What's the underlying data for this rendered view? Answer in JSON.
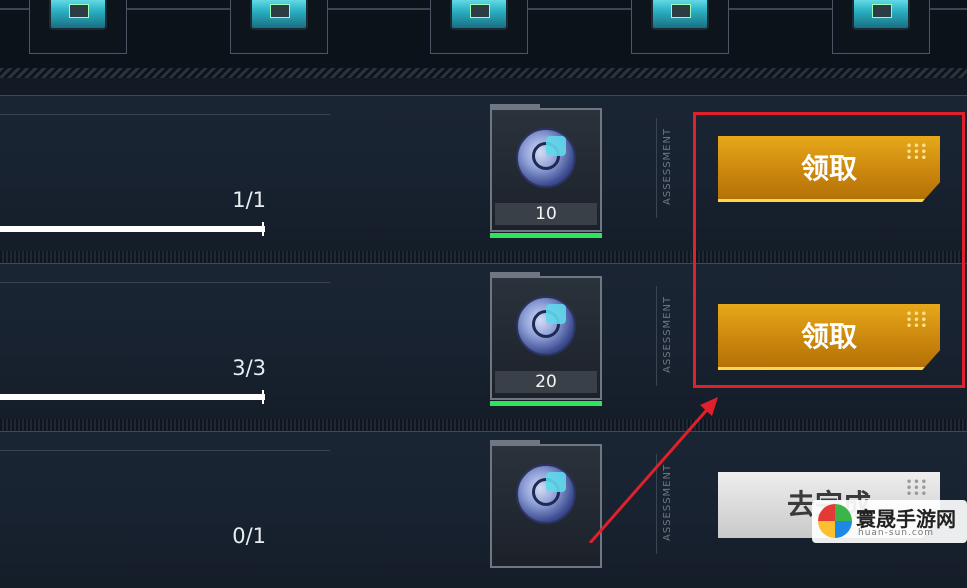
{
  "tasks": [
    {
      "progress": "1/1",
      "reward_qty": "10",
      "side_label": "ASSESSMENT",
      "button_label": "领取"
    },
    {
      "progress": "3/3",
      "reward_qty": "20",
      "side_label": "ASSESSMENT",
      "button_label": "领取"
    },
    {
      "progress": "0/1",
      "reward_qty": "",
      "side_label": "ASSESSMENT",
      "button_label": "去完成"
    }
  ],
  "colors": {
    "claim_button": "#d9950f",
    "highlight_box": "#e0202a",
    "reward_complete_bar": "#2fe35a"
  },
  "icons": [
    "supply-chest-icon",
    "coin-reward-icon",
    "dots-grid-icon",
    "arrow-annotation"
  ],
  "watermark": {
    "name": "寰晟手游网",
    "url": "huan-sun.com"
  }
}
